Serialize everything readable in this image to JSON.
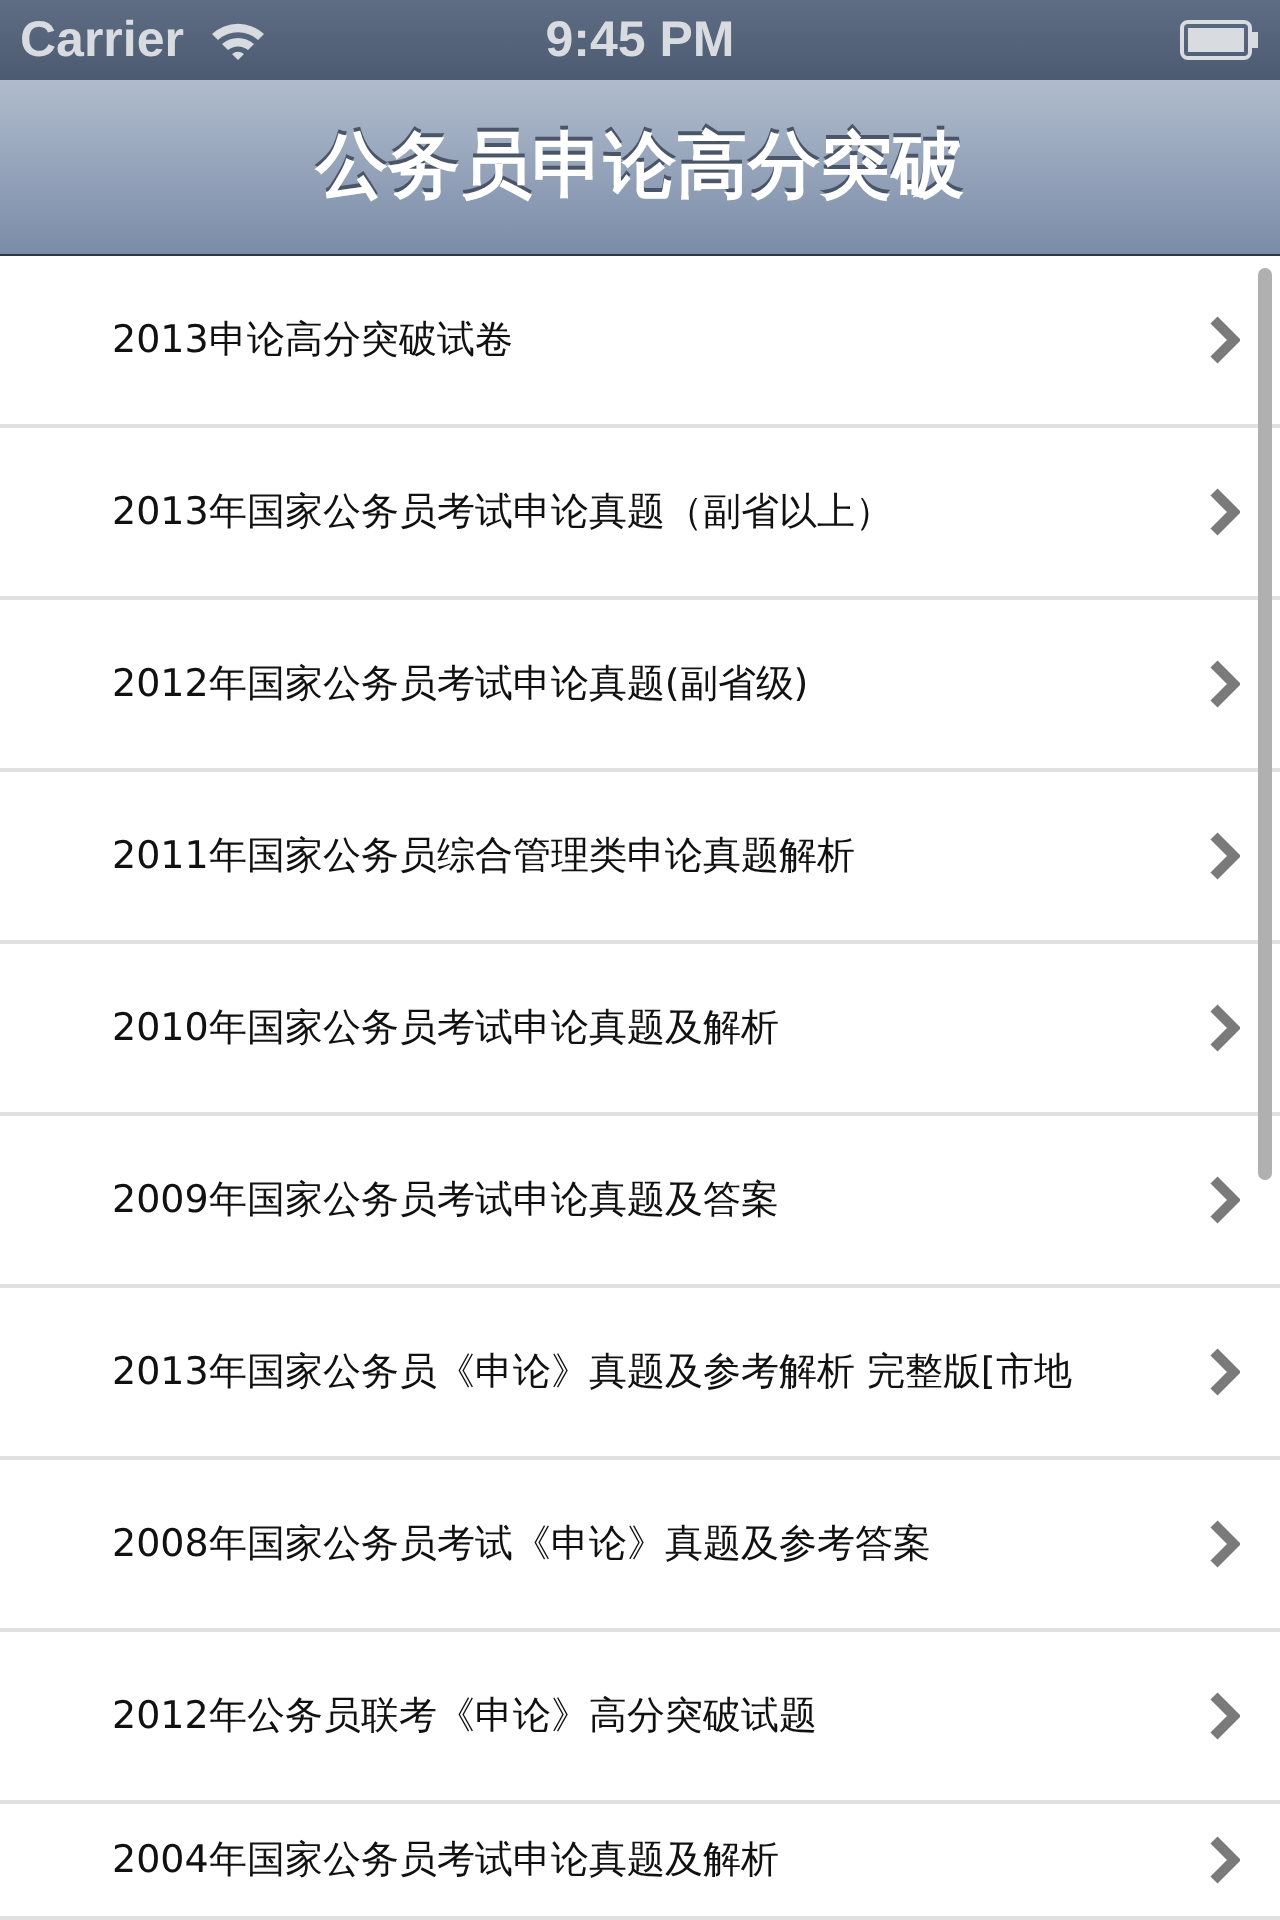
{
  "status_bar": {
    "carrier": "Carrier",
    "time": "9:45 PM"
  },
  "nav_bar": {
    "title": "公务员申论高分突破"
  },
  "list": {
    "items": [
      {
        "label": "2013申论高分突破试卷"
      },
      {
        "label": "2013年国家公务员考试申论真题（副省以上）"
      },
      {
        "label": "2012年国家公务员考试申论真题(副省级)"
      },
      {
        "label": "2011年国家公务员综合管理类申论真题解析"
      },
      {
        "label": "2010年国家公务员考试申论真题及解析"
      },
      {
        "label": "2009年国家公务员考试申论真题及答案"
      },
      {
        "label": "2013年国家公务员《申论》真题及参考解析 完整版[市地"
      },
      {
        "label": "2008年国家公务员考试《申论》真题及参考答案"
      },
      {
        "label": "2012年公务员联考《申论》高分突破试题"
      },
      {
        "label": "2004年国家公务员考试申论真题及解析"
      }
    ]
  }
}
